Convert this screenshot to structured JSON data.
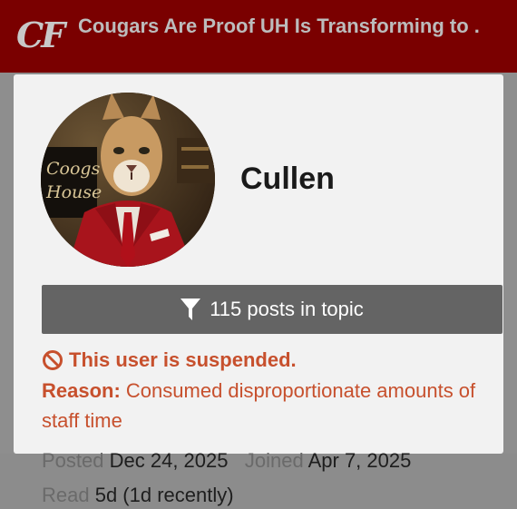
{
  "header": {
    "logo_text": "CF",
    "topic_title": "Cougars Are Proof UH Is Transforming to ..."
  },
  "user": {
    "name": "Cullen",
    "avatar_sign_line1": "Coogs",
    "avatar_sign_line2": "House"
  },
  "filter_button": {
    "icon": "filter-icon",
    "label": "115 posts in topic"
  },
  "suspension": {
    "icon": "ban-icon",
    "title": "This user is suspended.",
    "reason_label": "Reason:",
    "reason_text": "Consumed disproportionate amounts of staff time"
  },
  "stats": {
    "posted_label": "Posted",
    "posted_value": "Dec 24, 2025",
    "joined_label": "Joined",
    "joined_value": "Apr 7, 2025",
    "read_label": "Read",
    "read_value": "5d (1d recently)"
  },
  "colors": {
    "header_bg": "#7a0000",
    "suspend_text": "#c7502d",
    "button_bg": "#646464"
  }
}
